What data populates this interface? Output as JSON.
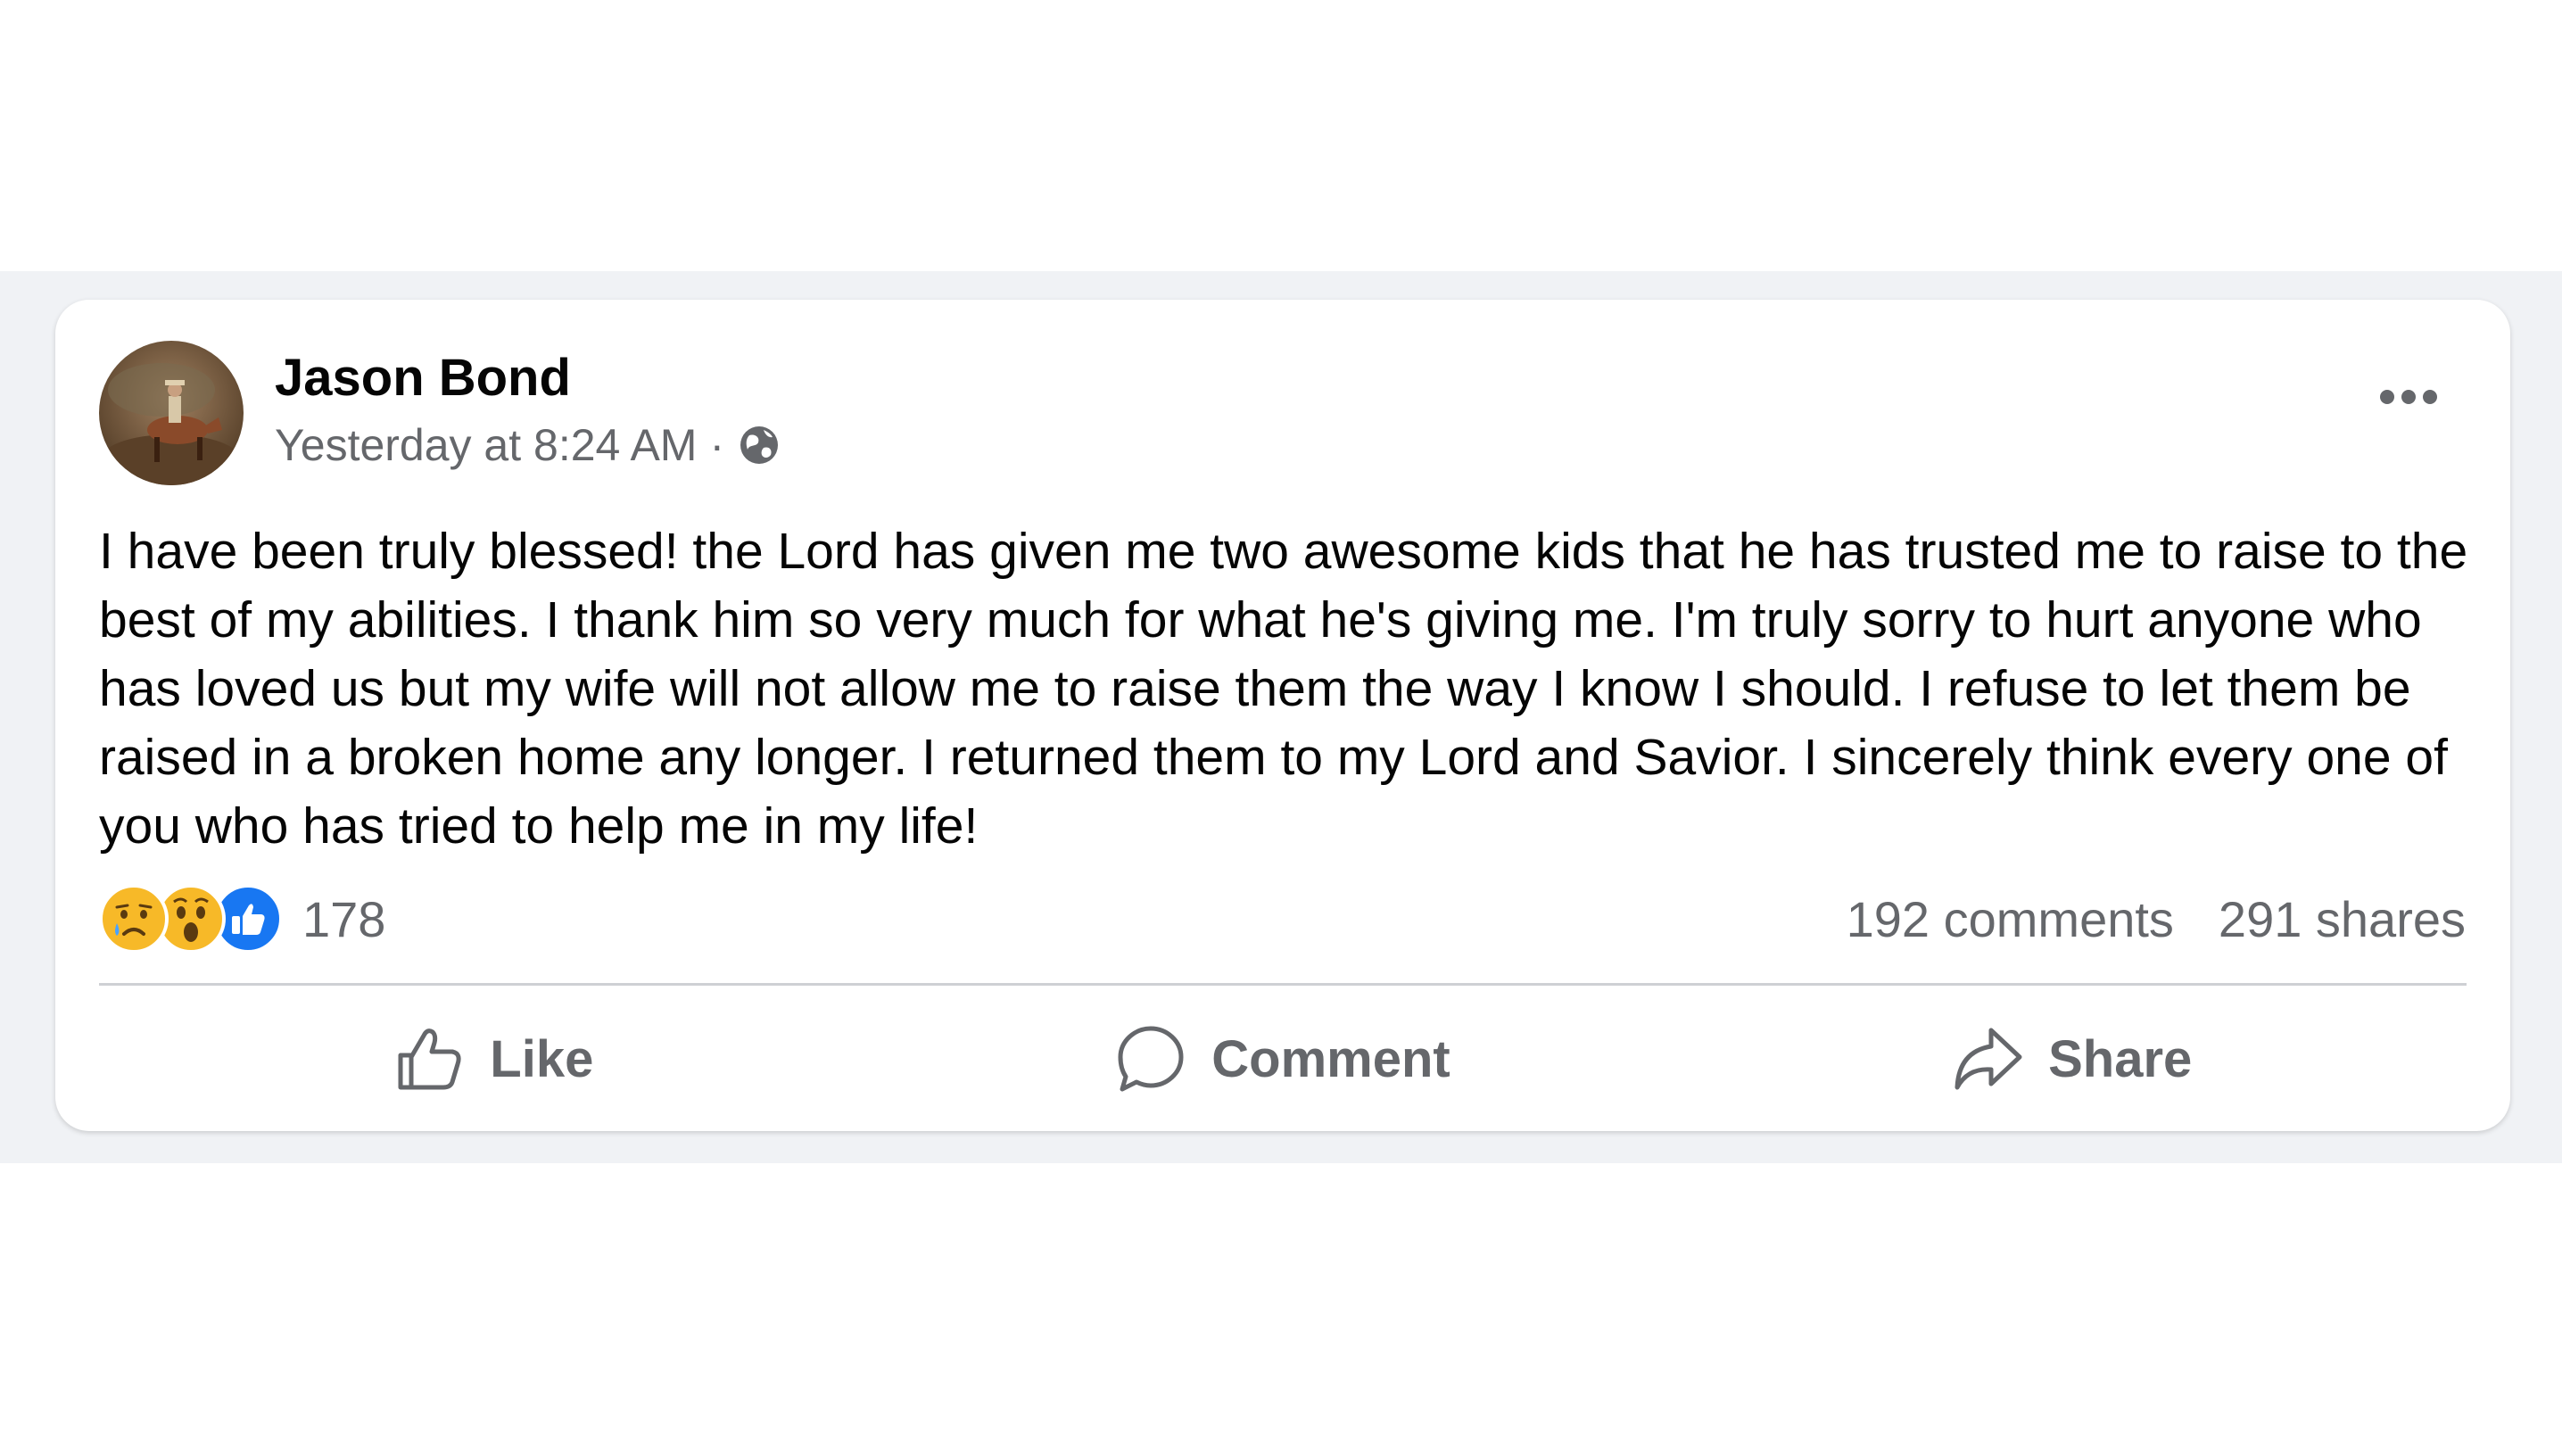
{
  "post": {
    "author": "Jason Bond",
    "timestamp": "Yesterday at 8:24 AM",
    "separator": "·",
    "privacy_icon": "globe-icon",
    "text": "I have been truly blessed! the Lord has given me two awesome kids that he has trusted me to raise to the best of my abilities. I thank him so very much for what he's giving me. I'm truly sorry to hurt anyone who has loved us but my wife will not allow me to raise them the way I know I should. I refuse to let them be raised in a broken home any longer. I returned them to my Lord and Savior. I sincerely think every one of you who has tried to help me in my life!",
    "reactions": {
      "icons": [
        "sad-reaction-icon",
        "wow-reaction-icon",
        "like-reaction-icon"
      ],
      "count": "178"
    },
    "comments": "192 comments",
    "shares": "291 shares",
    "actions": {
      "like": "Like",
      "comment": "Comment",
      "share": "Share"
    }
  },
  "colors": {
    "band_background": "#f0f2f5",
    "secondary_text": "#65676b",
    "like_blue": "#1877f2",
    "reaction_yellow": "#f7b928"
  }
}
